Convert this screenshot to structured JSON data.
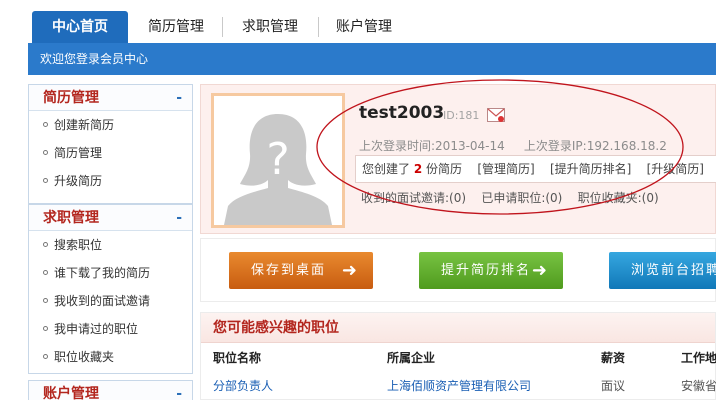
{
  "tabs": [
    "中心首页",
    "简历管理",
    "求职管理",
    "账户管理"
  ],
  "welcome": "欢迎您登录会员中心",
  "sidebar": {
    "sections": [
      {
        "title": "简历管理",
        "toggle": "-",
        "items": [
          "创建新简历",
          "简历管理",
          "升级简历"
        ]
      },
      {
        "title": "求职管理",
        "toggle": "-",
        "items": [
          "搜索职位",
          "谁下载了我的简历",
          "我收到的面试邀请",
          "我申请过的职位",
          "职位收藏夹"
        ]
      },
      {
        "title": "账户管理",
        "toggle": "-",
        "items": []
      }
    ]
  },
  "profile": {
    "username": "test2003",
    "uid": "ID:181",
    "last_login_time_label": "上次登录时间:",
    "last_login_time": "2013-04-14",
    "last_login_ip_label": "上次登录IP:",
    "last_login_ip": "192.168.18.2",
    "created_prefix": "您创建了",
    "resume_count": "2",
    "created_suffix": "份简历",
    "links": [
      "[管理简历]",
      "[提升简历排名]",
      "[升级简历]"
    ],
    "stats": [
      {
        "label": "收到的面试邀请:",
        "value": "(0)"
      },
      {
        "label": "已申请职位:",
        "value": "(0)"
      },
      {
        "label": "职位收藏夹:",
        "value": "(0)"
      }
    ]
  },
  "actions": {
    "save": "保存到桌面",
    "promote": "提升简历排名",
    "browse": "浏览前台招聘"
  },
  "jobs": {
    "title": "您可能感兴趣的职位",
    "headers": [
      "职位名称",
      "所属企业",
      "薪资",
      "工作地"
    ],
    "rows": [
      {
        "name": "分部负责人",
        "company": "上海佰顺资产管理有限公司",
        "salary": "面议",
        "place": "安徽省"
      }
    ]
  },
  "colors": {
    "accent": "#1f6cbc",
    "red_heading": "#b3261e",
    "annotation": "#c0141c"
  }
}
